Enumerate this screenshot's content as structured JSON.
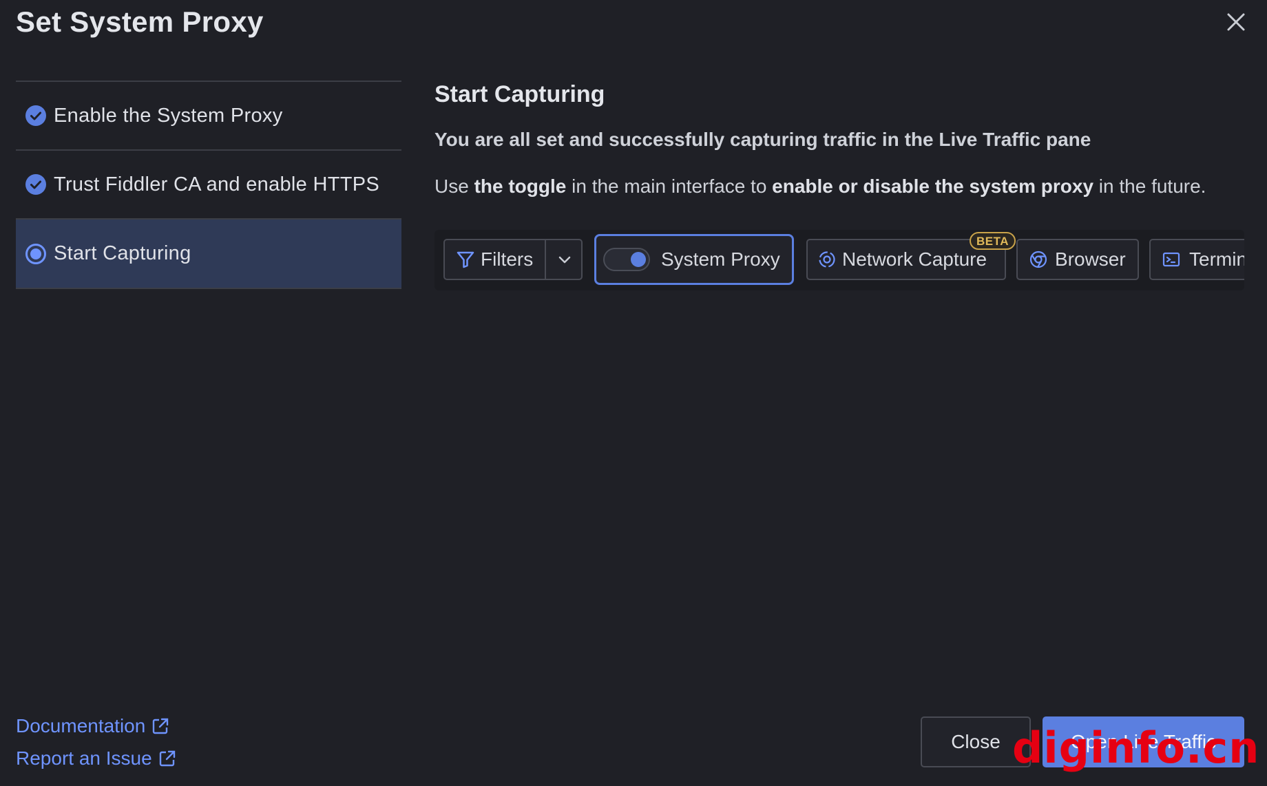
{
  "dialog": {
    "title": "Set System Proxy",
    "close_icon": "close-icon"
  },
  "steps": [
    {
      "label": "Enable the System Proxy",
      "state": "done",
      "icon": "check-circle-icon"
    },
    {
      "label": "Trust Fiddler CA and enable HTTPS",
      "state": "done",
      "icon": "check-circle-icon"
    },
    {
      "label": "Start Capturing",
      "state": "active",
      "icon": "radio-active-icon"
    }
  ],
  "content": {
    "heading": "Start Capturing",
    "lead": "You are all set and successfully capturing traffic in the Live Traffic pane",
    "desc": {
      "p1": "Use ",
      "b1": "the toggle",
      "p2": " in the main interface to ",
      "b2": "enable or disable the system proxy",
      "p3": " in the future."
    }
  },
  "toolbar": {
    "filters_label": "Filters",
    "system_proxy_label": "System Proxy",
    "system_proxy_on": true,
    "network_capture_label": "Network Capture",
    "beta_badge": "BETA",
    "browser_label": "Browser",
    "terminal_label": "Terminal"
  },
  "footer": {
    "documentation_link": "Documentation",
    "report_link": "Report an Issue",
    "close_button": "Close",
    "primary_button": "Open Live Traffic",
    "watermark": "diginfo.cn"
  },
  "colors": {
    "accent": "#5b7fe0",
    "link": "#6f94ff",
    "background": "#1f2026",
    "active_step": "#2f3a57",
    "beta": "#e0b95a"
  }
}
